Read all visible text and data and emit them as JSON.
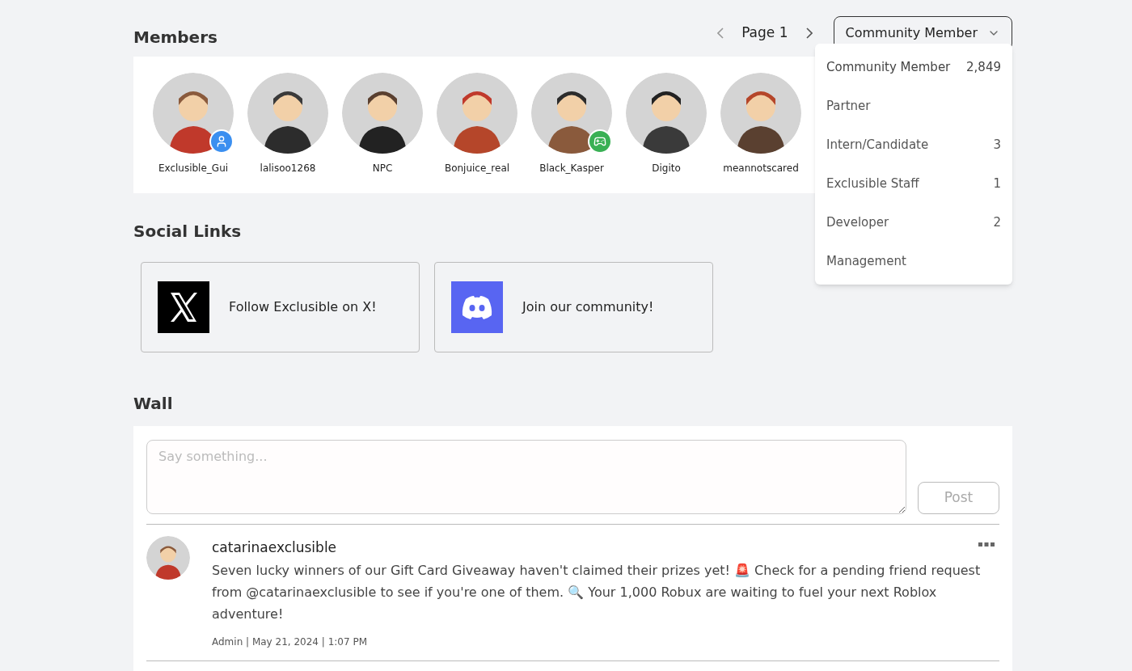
{
  "members": {
    "title": "Members",
    "page": "Page 1",
    "role_select": {
      "value": "Community Member",
      "expanded": true,
      "options": [
        {
          "label": "Community Member",
          "count": "2,849",
          "selected": true
        },
        {
          "label": "Partner",
          "selected": false
        },
        {
          "label": "Intern/Candidate",
          "count": "3",
          "selected": false
        },
        {
          "label": "Exclusible Staff",
          "count": "1",
          "selected": false
        },
        {
          "label": "Developer",
          "count": "2",
          "selected": false
        },
        {
          "label": "Management",
          "selected": false
        }
      ]
    },
    "list": [
      {
        "name": "Exclusible_Gui",
        "kind": "profile"
      },
      {
        "name": "lalisoo1268",
        "kind": "plain"
      },
      {
        "name": "NPC",
        "kind": "plain"
      },
      {
        "name": "Bonjuice_real",
        "kind": "plain"
      },
      {
        "name": "Black_Kasper",
        "kind": "game"
      },
      {
        "name": "Digito",
        "kind": "plain"
      },
      {
        "name": "meannotscared",
        "kind": "plain"
      }
    ]
  },
  "social_links": {
    "title": "Social Links",
    "links": [
      {
        "kind": "x",
        "label": "Follow Exclusible on X!"
      },
      {
        "kind": "discord",
        "label": "Join our community!"
      }
    ]
  },
  "wall": {
    "title": "Wall",
    "input": {
      "placeholder": "Say something..."
    },
    "post_button": {
      "label": "Post",
      "disabled": true
    },
    "posts": [
      {
        "author": "catarinaexclusible",
        "text": "Seven lucky winners of our Gift Card Giveaway haven't claimed their prizes yet! 🚨 Check for a pending friend request from @catarinaexclusible to see if you're one of them. 🔍 Your 1,000 Robux are waiting to fuel your next Roblox adventure!",
        "meta": "Admin | May 21, 2024 | 1:07 PM"
      }
    ]
  }
}
